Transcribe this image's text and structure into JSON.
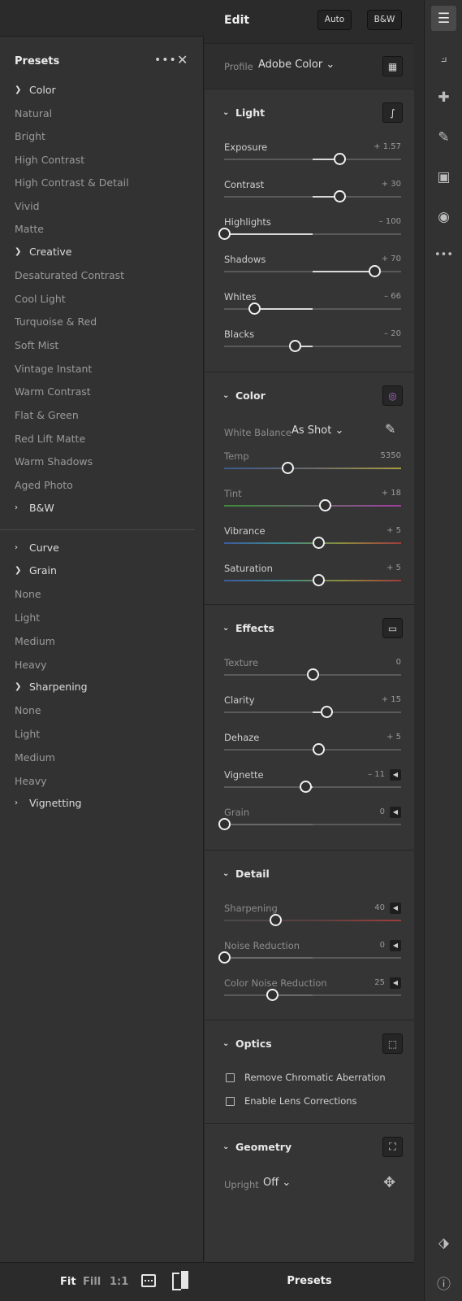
{
  "presets": {
    "title": "Presets",
    "more_glyph": "•••",
    "close_glyph": "✕",
    "groups": {
      "color": {
        "label": "Color",
        "items": [
          "Natural",
          "Bright",
          "High Contrast",
          "High Contrast & Detail",
          "Vivid",
          "Matte"
        ]
      },
      "creative": {
        "label": "Creative",
        "items": [
          "Desaturated Contrast",
          "Cool Light",
          "Turquoise & Red",
          "Soft Mist",
          "Vintage Instant",
          "Warm Contrast",
          "Flat & Green",
          "Red Lift Matte",
          "Warm Shadows",
          "Aged Photo"
        ]
      },
      "bw": {
        "label": "B&W"
      },
      "curve": {
        "label": "Curve"
      },
      "grain": {
        "label": "Grain",
        "items": [
          "None",
          "Light",
          "Medium",
          "Heavy"
        ]
      },
      "sharpening": {
        "label": "Sharpening",
        "items": [
          "None",
          "Light",
          "Medium",
          "Heavy"
        ]
      },
      "vignetting": {
        "label": "Vignetting"
      }
    }
  },
  "view_controls": {
    "fit": "Fit",
    "fill": "Fill",
    "one_to_one": "1:1"
  },
  "edit": {
    "title": "Edit",
    "auto_label": "Auto",
    "bw_label": "B&W",
    "profile_label": "Profile",
    "profile_value": "Adobe Color ⌄",
    "light": {
      "title": "Light",
      "sliders": [
        {
          "label": "Exposure",
          "value": "+ 1.57",
          "position": 0.65
        },
        {
          "label": "Contrast",
          "value": "+ 30",
          "position": 0.65
        },
        {
          "label": "Highlights",
          "value": "– 100",
          "position": 0.0
        },
        {
          "label": "Shadows",
          "value": "+ 70",
          "position": 0.85
        },
        {
          "label": "Whites",
          "value": "– 66",
          "position": 0.17
        },
        {
          "label": "Blacks",
          "value": "– 20",
          "position": 0.4
        }
      ]
    },
    "color": {
      "title": "Color",
      "white_balance_label": "White Balance",
      "white_balance_value": "As Shot ⌄",
      "sliders": [
        {
          "label": "Temp",
          "value": "5350",
          "position": 0.36
        },
        {
          "label": "Tint",
          "value": "+ 18",
          "position": 0.57
        },
        {
          "label": "Vibrance",
          "value": "+ 5",
          "position": 0.53
        },
        {
          "label": "Saturation",
          "value": "+ 5",
          "position": 0.53
        }
      ]
    },
    "effects": {
      "title": "Effects",
      "sliders": [
        {
          "label": "Texture",
          "value": "0",
          "position": 0.5
        },
        {
          "label": "Clarity",
          "value": "+ 15",
          "position": 0.58
        },
        {
          "label": "Dehaze",
          "value": "+ 5",
          "position": 0.53
        },
        {
          "label": "Vignette",
          "value": "– 11",
          "position": 0.46
        },
        {
          "label": "Grain",
          "value": "0",
          "position": 0.0
        }
      ]
    },
    "detail": {
      "title": "Detail",
      "sliders": [
        {
          "label": "Sharpening",
          "value": "40",
          "position": 0.29
        },
        {
          "label": "Noise Reduction",
          "value": "0",
          "position": 0.0
        },
        {
          "label": "Color Noise Reduction",
          "value": "25",
          "position": 0.27
        }
      ]
    },
    "optics": {
      "title": "Optics",
      "checkboxes": [
        "Remove Chromatic Aberration",
        "Enable Lens Corrections"
      ]
    },
    "geometry": {
      "title": "Geometry",
      "upright_label": "Upright",
      "upright_value": "Off ⌄"
    }
  },
  "bottom": {
    "presets_button": "Presets"
  },
  "tools": [
    "edit-sliders-icon",
    "crop-icon",
    "healing-icon",
    "brush-icon",
    "linear-gradient-icon",
    "radial-gradient-icon",
    "more-icon",
    "tag-icon",
    "info-icon"
  ],
  "colors": {
    "panel": "#353535",
    "background": "#2b2b2b",
    "accent": "#f0f0f0"
  }
}
